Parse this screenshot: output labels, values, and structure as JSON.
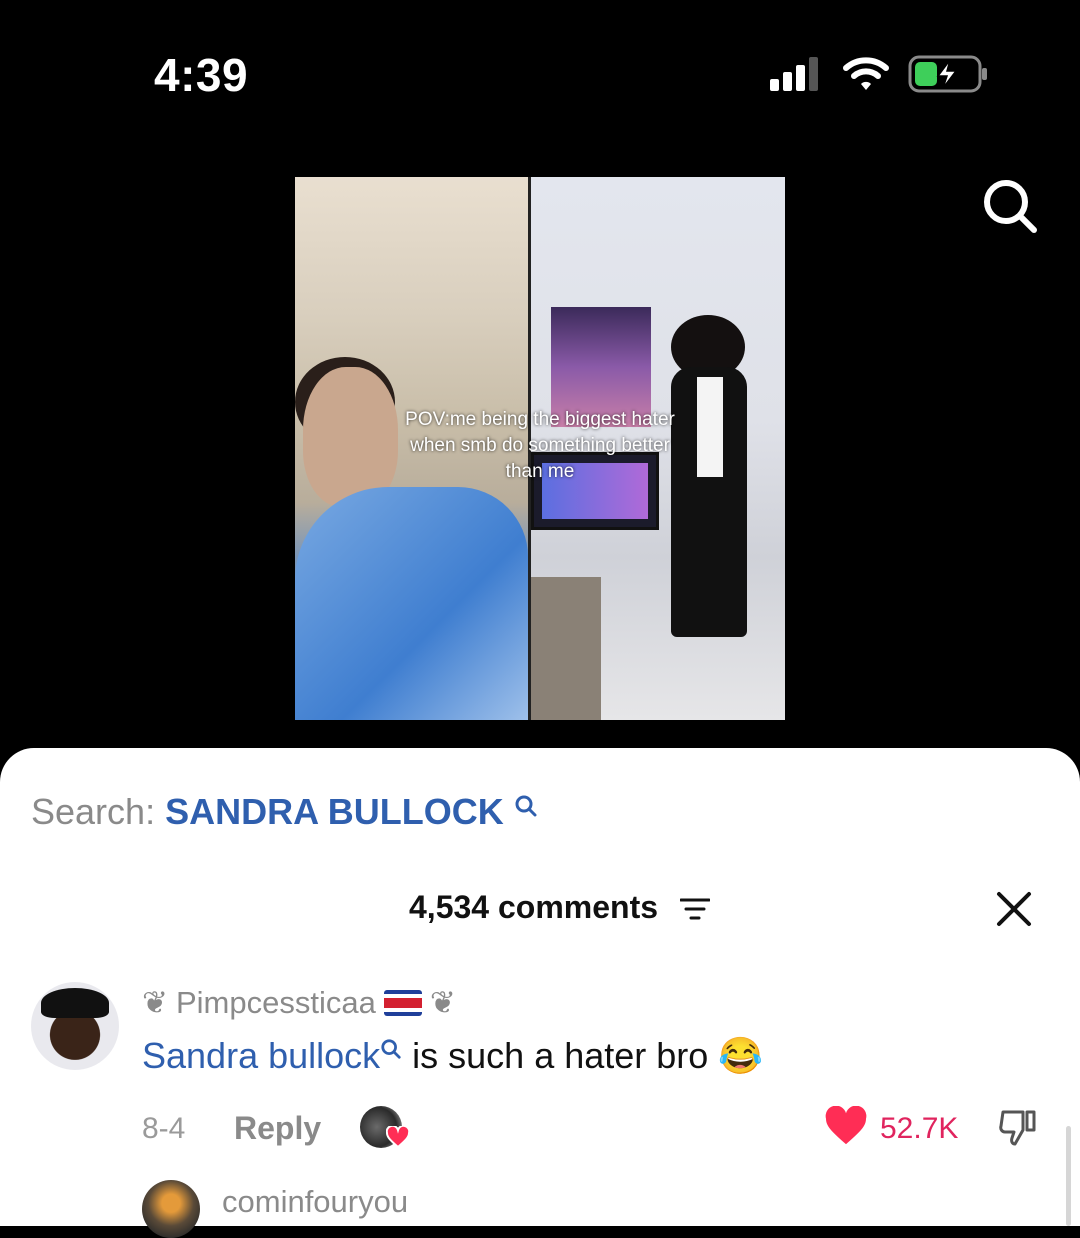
{
  "status_bar": {
    "time": "4:39"
  },
  "video": {
    "caption": "POV:me being the biggest hater when smb do something better than me"
  },
  "search_bar": {
    "label": "Search:",
    "term": "SANDRA BULLOCK"
  },
  "comments_header": {
    "count_label": "4,534 comments"
  },
  "comments": [
    {
      "username": "Pimpcessticaa",
      "username_prefix": "❦",
      "username_suffix": "❦",
      "mention": "Sandra bullock",
      "text": " is such a hater bro",
      "emoji": "😂",
      "date": "8-4",
      "reply_label": "Reply",
      "likes": "52.7K"
    },
    {
      "username": "cominfouryou"
    }
  ],
  "colors": {
    "link_blue": "#2f5fae",
    "like_red": "#e0245e",
    "muted_gray": "#8a8a8a"
  }
}
